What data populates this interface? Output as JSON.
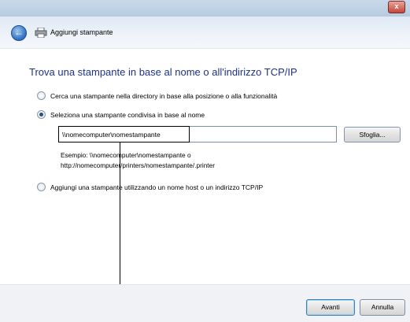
{
  "window": {
    "close_label": "x"
  },
  "nav": {
    "back_symbol": "←",
    "title": "Aggiungi stampante",
    "icons": [
      "back-arrow-icon",
      "printer-icon"
    ]
  },
  "main": {
    "heading": "Trova una stampante in base al nome o all'indirizzo TCP/IP",
    "options": [
      {
        "label": "Cerca una stampante nella directory in base alla posizione o alla funzionalità",
        "selected": false
      },
      {
        "label": "Seleziona una stampante condivisa in base al nome",
        "selected": true
      },
      {
        "label": "Aggiungi una stampante utilizzando un nome host o un indirizzo TCP/IP",
        "selected": false
      }
    ],
    "shared_name_value": "\\\\nomecomputer\\nomestampante",
    "browse_label": "Sfoglia...",
    "example_line1": "Esempio: \\\\nomecomputer\\nomestampante o",
    "example_line2": "http://nomecomputer/printers/nomestampante/.printer"
  },
  "footer": {
    "next_label": "Avanti",
    "cancel_label": "Annulla"
  },
  "colors": {
    "heading": "#1e3287",
    "accent": "#2d6fc2"
  }
}
